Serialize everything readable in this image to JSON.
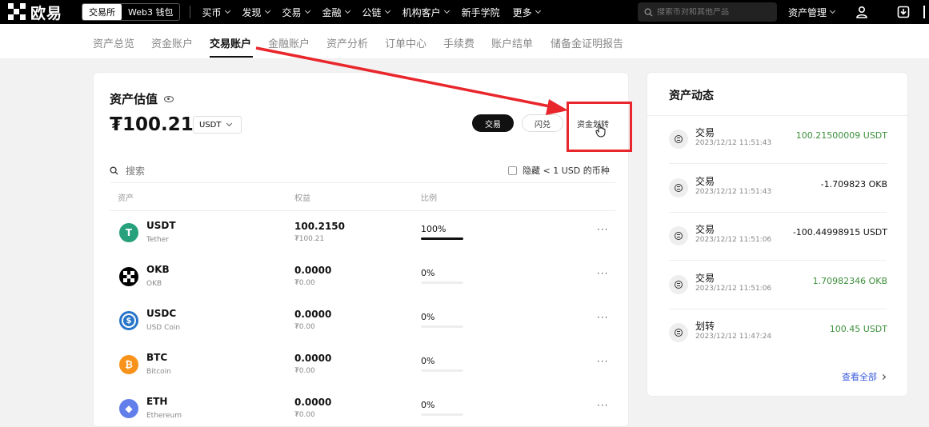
{
  "topbar": {
    "brand": "欧易",
    "segments": [
      "交易所",
      "Web3 钱包"
    ],
    "menu": [
      {
        "label": "买币",
        "caret": true
      },
      {
        "label": "发现",
        "caret": true
      },
      {
        "label": "交易",
        "caret": true
      },
      {
        "label": "金融",
        "caret": true
      },
      {
        "label": "公链",
        "caret": true
      },
      {
        "label": "机构客户",
        "caret": true
      },
      {
        "label": "新手学院",
        "caret": false
      },
      {
        "label": "更多",
        "caret": true
      }
    ],
    "search_placeholder": "搜索币对和其他产品",
    "asset_management": "资产管理"
  },
  "subnav": {
    "tabs": [
      "资产总览",
      "资金账户",
      "交易账户",
      "金融账户",
      "资产分析",
      "订单中心",
      "手续费",
      "账户结单",
      "储备金证明报告"
    ],
    "active_index": 2
  },
  "estimate": {
    "title": "资产估值",
    "value": "₮100.21",
    "unit": "USDT",
    "buttons": {
      "trade": "交易",
      "flash": "闪兑",
      "transfer": "资金划转"
    }
  },
  "table": {
    "search_placeholder": "搜索",
    "hide_small": "隐藏 < 1 USD 的币种",
    "columns": [
      "资产",
      "权益",
      "比例"
    ],
    "rows": [
      {
        "symbol": "USDT",
        "name": "Tether",
        "equity": "100.2150",
        "equity_fiat": "₮100.21",
        "ratio": "100%",
        "ratio_value": 1.0,
        "color": "#26a17b",
        "icon_glyph": "T"
      },
      {
        "symbol": "OKB",
        "name": "OKB",
        "equity": "0.0000",
        "equity_fiat": "₮0.00",
        "ratio": "0%",
        "ratio_value": 0,
        "color": "#000000",
        "icon_glyph": ""
      },
      {
        "symbol": "USDC",
        "name": "USD Coin",
        "equity": "0.0000",
        "equity_fiat": "₮0.00",
        "ratio": "0%",
        "ratio_value": 0,
        "color": "#2775ca",
        "icon_glyph": "$"
      },
      {
        "symbol": "BTC",
        "name": "Bitcoin",
        "equity": "0.0000",
        "equity_fiat": "₮0.00",
        "ratio": "0%",
        "ratio_value": 0,
        "color": "#f7931a",
        "icon_glyph": "₿"
      },
      {
        "symbol": "ETH",
        "name": "Ethereum",
        "equity": "0.0000",
        "equity_fiat": "₮0.00",
        "ratio": "0%",
        "ratio_value": 0,
        "color": "#627eea",
        "icon_glyph": "◆"
      }
    ],
    "more_label": "···"
  },
  "activity": {
    "title": "资产动态",
    "items": [
      {
        "type": "交易",
        "time": "2023/12/12 11:51:43",
        "amount": "100.21500009 USDT",
        "color": "#3c8f3c"
      },
      {
        "type": "交易",
        "time": "2023/12/12 11:51:43",
        "amount": "-1.709823 OKB",
        "color": "#111111"
      },
      {
        "type": "交易",
        "time": "2023/12/12 11:51:06",
        "amount": "-100.44998915 USDT",
        "color": "#111111"
      },
      {
        "type": "交易",
        "time": "2023/12/12 11:51:06",
        "amount": "1.70982346 OKB",
        "color": "#3c8f3c"
      },
      {
        "type": "划转",
        "time": "2023/12/12 11:47:24",
        "amount": "100.45 USDT",
        "color": "#3c8f3c"
      }
    ],
    "view_all": "查看全部"
  },
  "annotation": {
    "color": "#e8262b"
  }
}
